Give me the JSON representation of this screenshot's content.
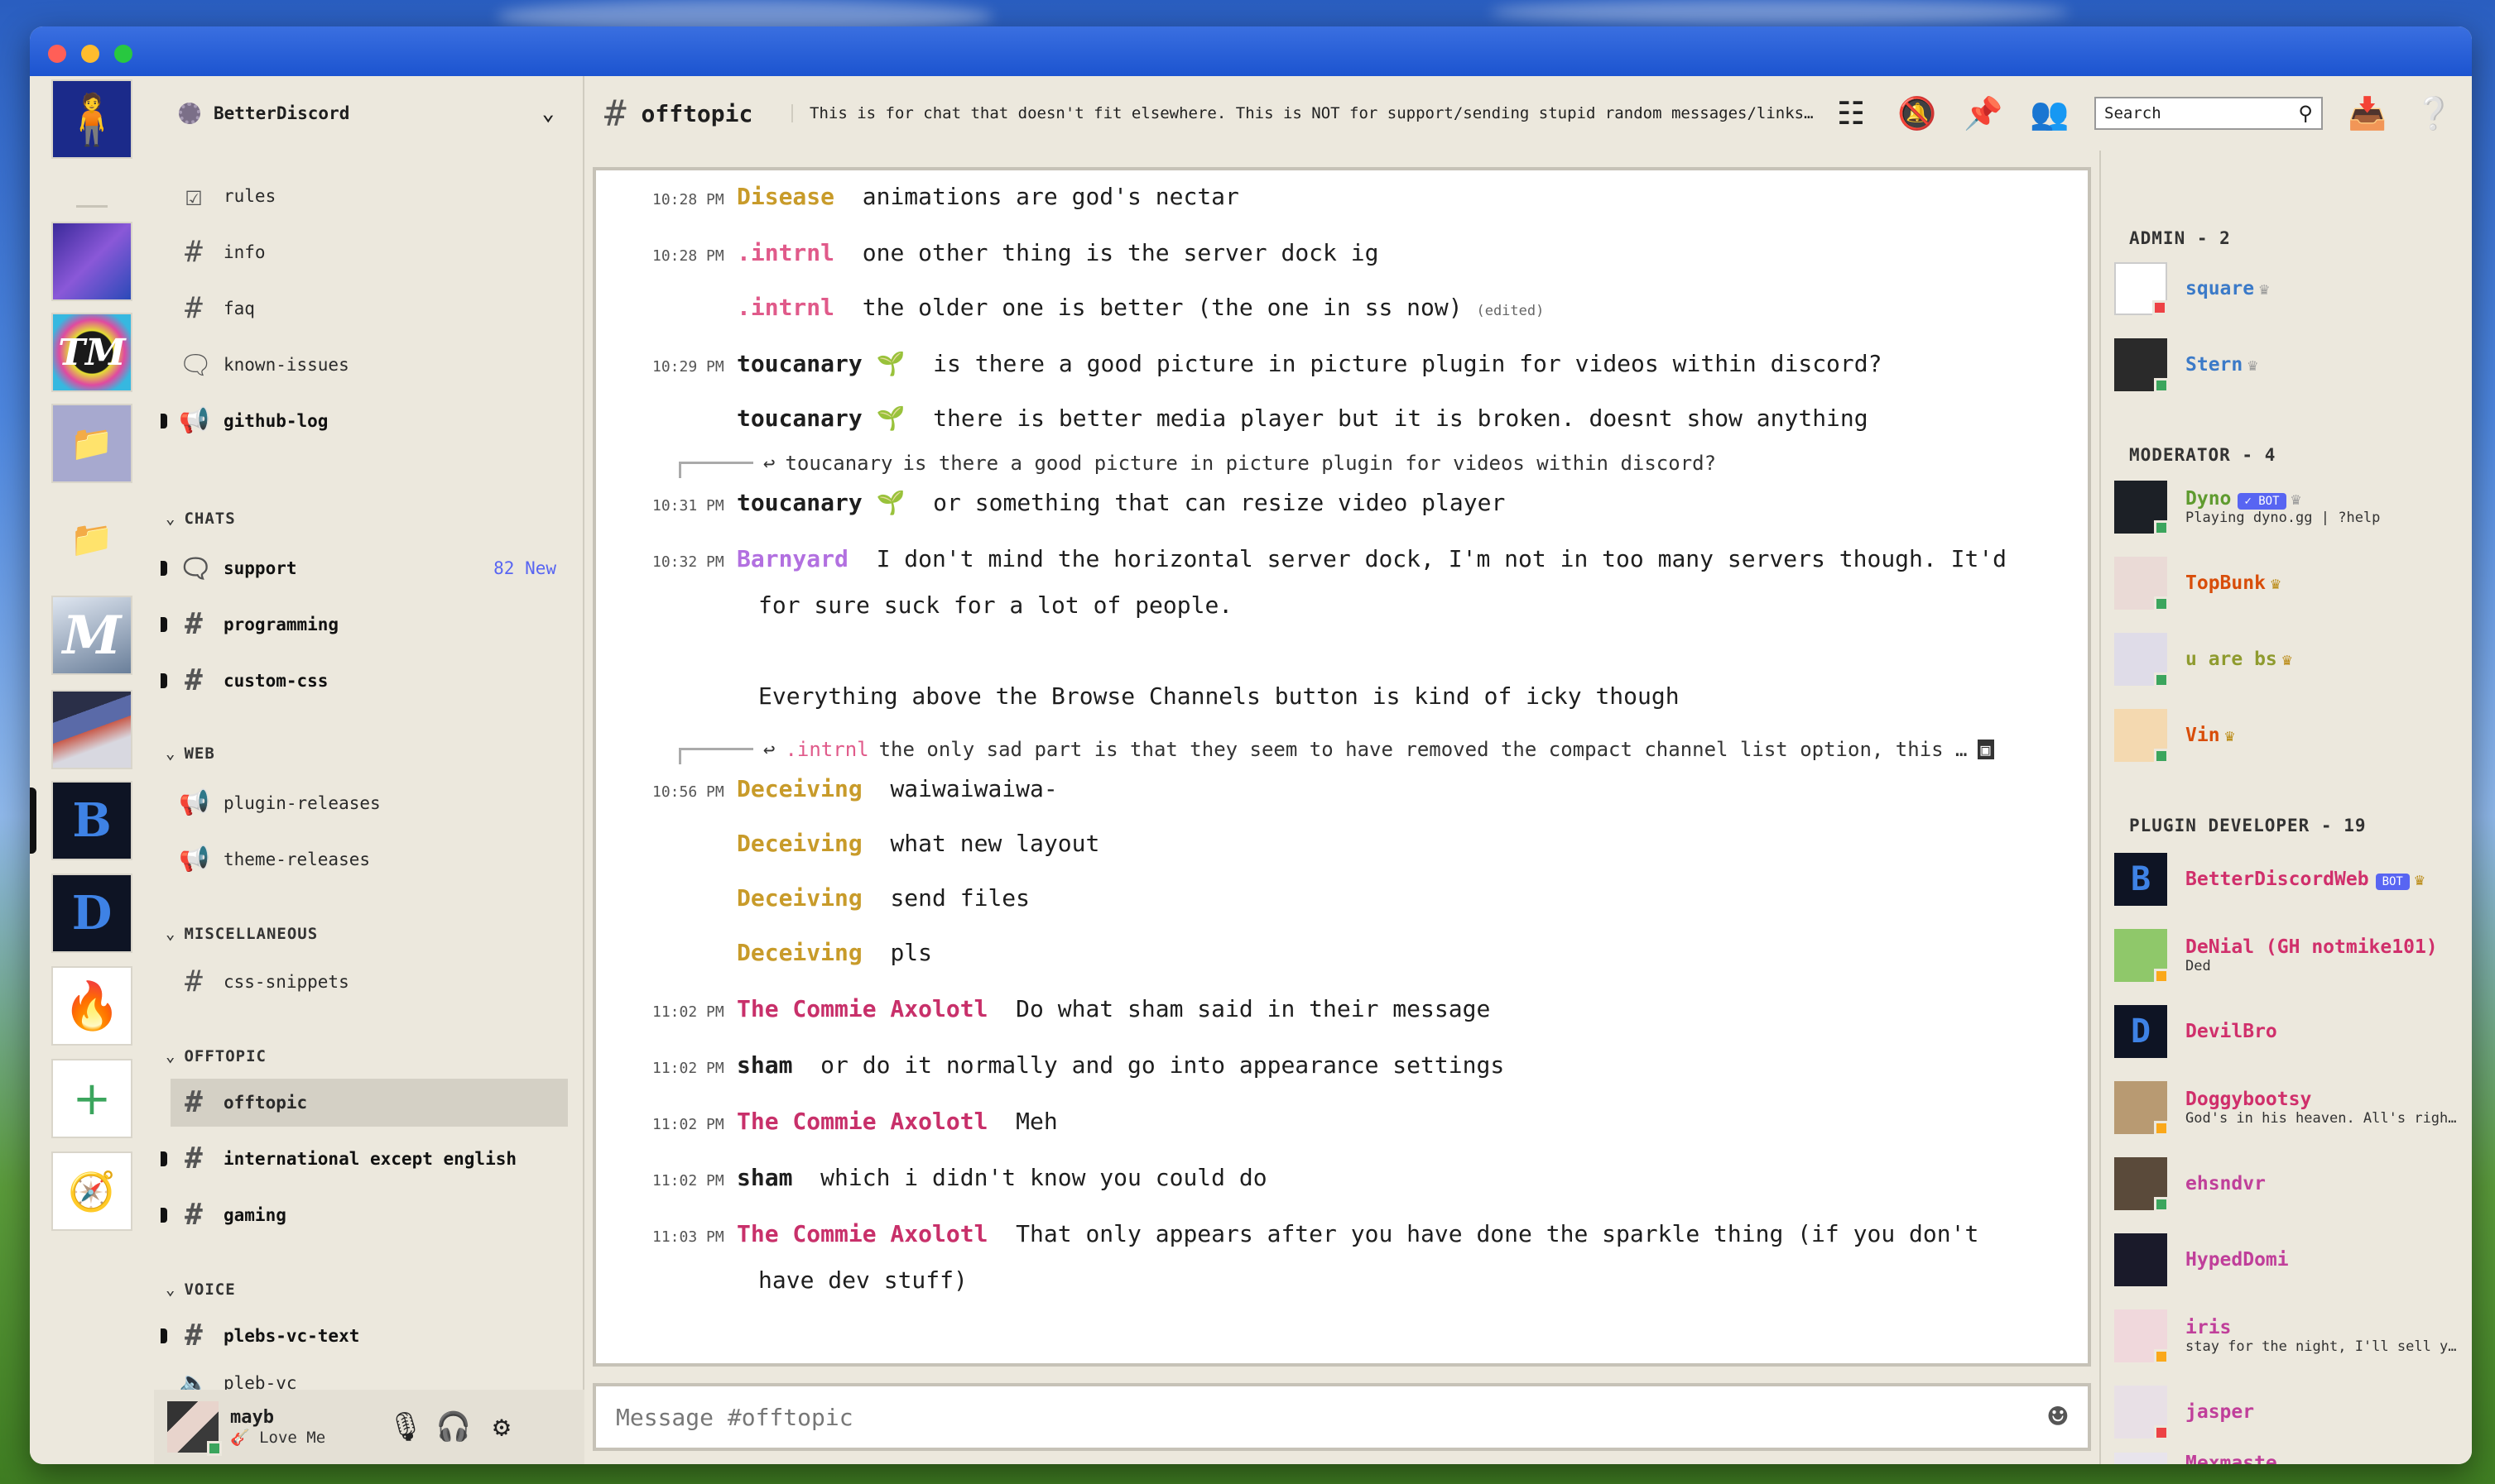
{
  "window": {
    "accent": "#1c54d0",
    "background": "#ece8dd"
  },
  "guild": {
    "name": "BetterDiscord"
  },
  "channels": {
    "top": [
      {
        "name": "rules",
        "icon": "rules-checkbox-icon"
      },
      {
        "name": "info",
        "icon": "hash-icon"
      },
      {
        "name": "faq",
        "icon": "hash-icon"
      },
      {
        "name": "known-issues",
        "icon": "forum-icon"
      },
      {
        "name": "github-log",
        "icon": "announcement-icon"
      }
    ],
    "categories": [
      {
        "name": "CHATS",
        "items": [
          {
            "name": "support",
            "badge": "82 New"
          },
          {
            "name": "programming"
          },
          {
            "name": "custom-css"
          }
        ]
      },
      {
        "name": "WEB",
        "items": [
          {
            "name": "plugin-releases"
          },
          {
            "name": "theme-releases"
          }
        ]
      },
      {
        "name": "MISCELLANEOUS",
        "items": [
          {
            "name": "css-snippets"
          }
        ]
      },
      {
        "name": "OFFTOPIC",
        "items": [
          {
            "name": "offtopic"
          },
          {
            "name": "international except english"
          },
          {
            "name": "gaming"
          }
        ]
      },
      {
        "name": "VOICE",
        "items": [
          {
            "name": "plebs-vc-text"
          },
          {
            "name": "pleb-vc"
          }
        ]
      }
    ]
  },
  "user": {
    "name": "mayb",
    "status": "Love Me"
  },
  "header": {
    "channel": "offtopic",
    "topic": "This is for chat that doesn't fit elsewhere. This is NOT for support/sending stupid random messages/links/adv…",
    "search_placeholder": "Search"
  },
  "messages": [
    {
      "time": "10:28 PM",
      "author": "Disease",
      "text": "animations are god's nectar"
    },
    {
      "time": "10:28 PM",
      "author": ".intrnl",
      "text": "one other thing is the server dock ig"
    },
    {
      "time": "",
      "author": ".intrnl",
      "text": "the older one is better (the one in ss now)",
      "edited": "(edited)"
    },
    {
      "time": "10:29 PM",
      "author": "toucanary",
      "text": "is there a good picture in picture plugin for videos within discord?"
    },
    {
      "time": "",
      "author": "toucanary",
      "text": "there is better media player but it is broken. doesnt show anything"
    },
    {
      "reply_author": "toucanary",
      "reply_text": "is there a good picture in picture plugin for videos within discord?"
    },
    {
      "time": "10:31 PM",
      "author": "toucanary",
      "text": "or something that can resize video player"
    },
    {
      "time": "10:32 PM",
      "author": "Barnyard",
      "text": "I don't mind the horizontal server dock, I'm not in too many servers though. It'd",
      "text2": "for sure suck for a lot of people.",
      "text3": "Everything above the Browse Channels button is kind of icky though"
    },
    {
      "reply_author": ".intrnl",
      "reply_text": "the only sad part is that they seem to have removed the compact channel list option, this …"
    },
    {
      "time": "10:56 PM",
      "author": "Deceiving",
      "text": "waiwaiwaiwa-"
    },
    {
      "time": "",
      "author": "Deceiving",
      "text": "what new layout"
    },
    {
      "time": "",
      "author": "Deceiving",
      "text": "send files"
    },
    {
      "time": "",
      "author": "Deceiving",
      "text": "pls"
    },
    {
      "time": "11:02 PM",
      "author": "The Commie Axolotl",
      "text": "Do what sham said in their message"
    },
    {
      "time": "11:02 PM",
      "author": "sham",
      "text": "or do it normally and go into appearance settings"
    },
    {
      "time": "11:02 PM",
      "author": "The Commie Axolotl",
      "text": "Meh"
    },
    {
      "time": "11:02 PM",
      "author": "sham",
      "text": "which i didn't know you could do"
    },
    {
      "time": "11:03 PM",
      "author": "The Commie Axolotl",
      "text": "That only appears after you have done the sparkle thing (if you don't",
      "text2": "have dev stuff)"
    }
  ],
  "composer": {
    "placeholder": "Message #offtopic"
  },
  "members": {
    "roles": [
      {
        "name": "ADMIN - 2"
      },
      {
        "name": "MODERATOR - 4"
      },
      {
        "name": "PLUGIN DEVELOPER - 19"
      }
    ],
    "list": [
      {
        "name": "square"
      },
      {
        "name": "Stern"
      },
      {
        "name": "Dyno",
        "tag": "✓ BOT",
        "sub": "Playing dyno.gg | ?help"
      },
      {
        "name": "TopBunk"
      },
      {
        "name": "u are bs"
      },
      {
        "name": "Vin"
      },
      {
        "name": "BetterDiscordWeb",
        "tag": "BOT"
      },
      {
        "name": "DeNial (GH notmike101)",
        "sub": "Ded"
      },
      {
        "name": "DevilBro"
      },
      {
        "name": "Doggybootsy",
        "sub": "God's in his heaven. All's right wit…"
      },
      {
        "name": "ehsndvr"
      },
      {
        "name": "HypedDomi"
      },
      {
        "name": "iris",
        "sub": "stay for the night, I'll sell you a …"
      },
      {
        "name": "jasper"
      },
      {
        "name": "Mexmaste"
      }
    ]
  }
}
